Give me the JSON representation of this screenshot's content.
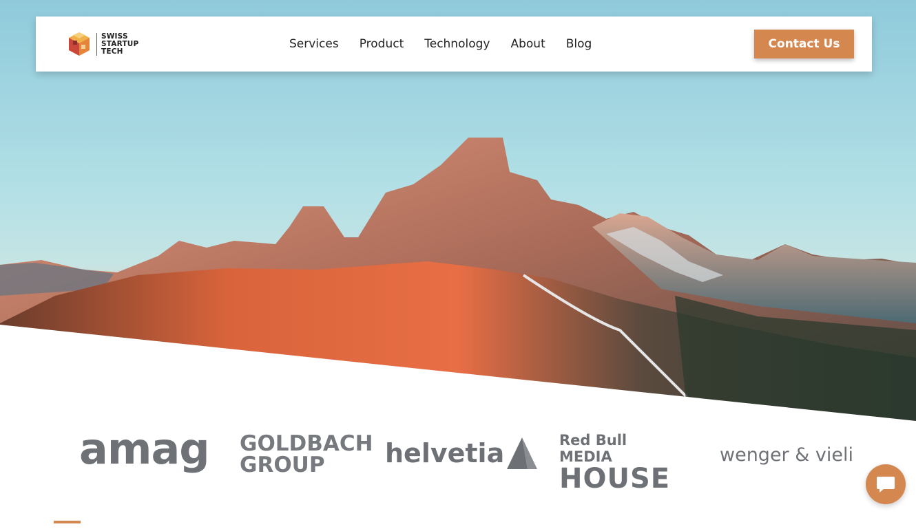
{
  "brand": {
    "name_lines": [
      "SWISS",
      "STARTUP",
      "TECH"
    ],
    "accent_color": "#d4874f"
  },
  "nav": {
    "links": [
      "Services",
      "Product",
      "Technology",
      "About",
      "Blog"
    ],
    "cta_label": "Contact Us"
  },
  "hero": {
    "image": "mountain-landscape"
  },
  "partners": {
    "amag": "amag",
    "goldbach_lines": [
      "GOLDBACH",
      "GROUP"
    ],
    "helvetia": "helvetia",
    "redbull_top": "Red Bull MEDIA",
    "redbull_bottom": "HOUSE",
    "wenger": "wenger & vieli"
  },
  "chat": {
    "icon": "chat-bubble-icon"
  }
}
